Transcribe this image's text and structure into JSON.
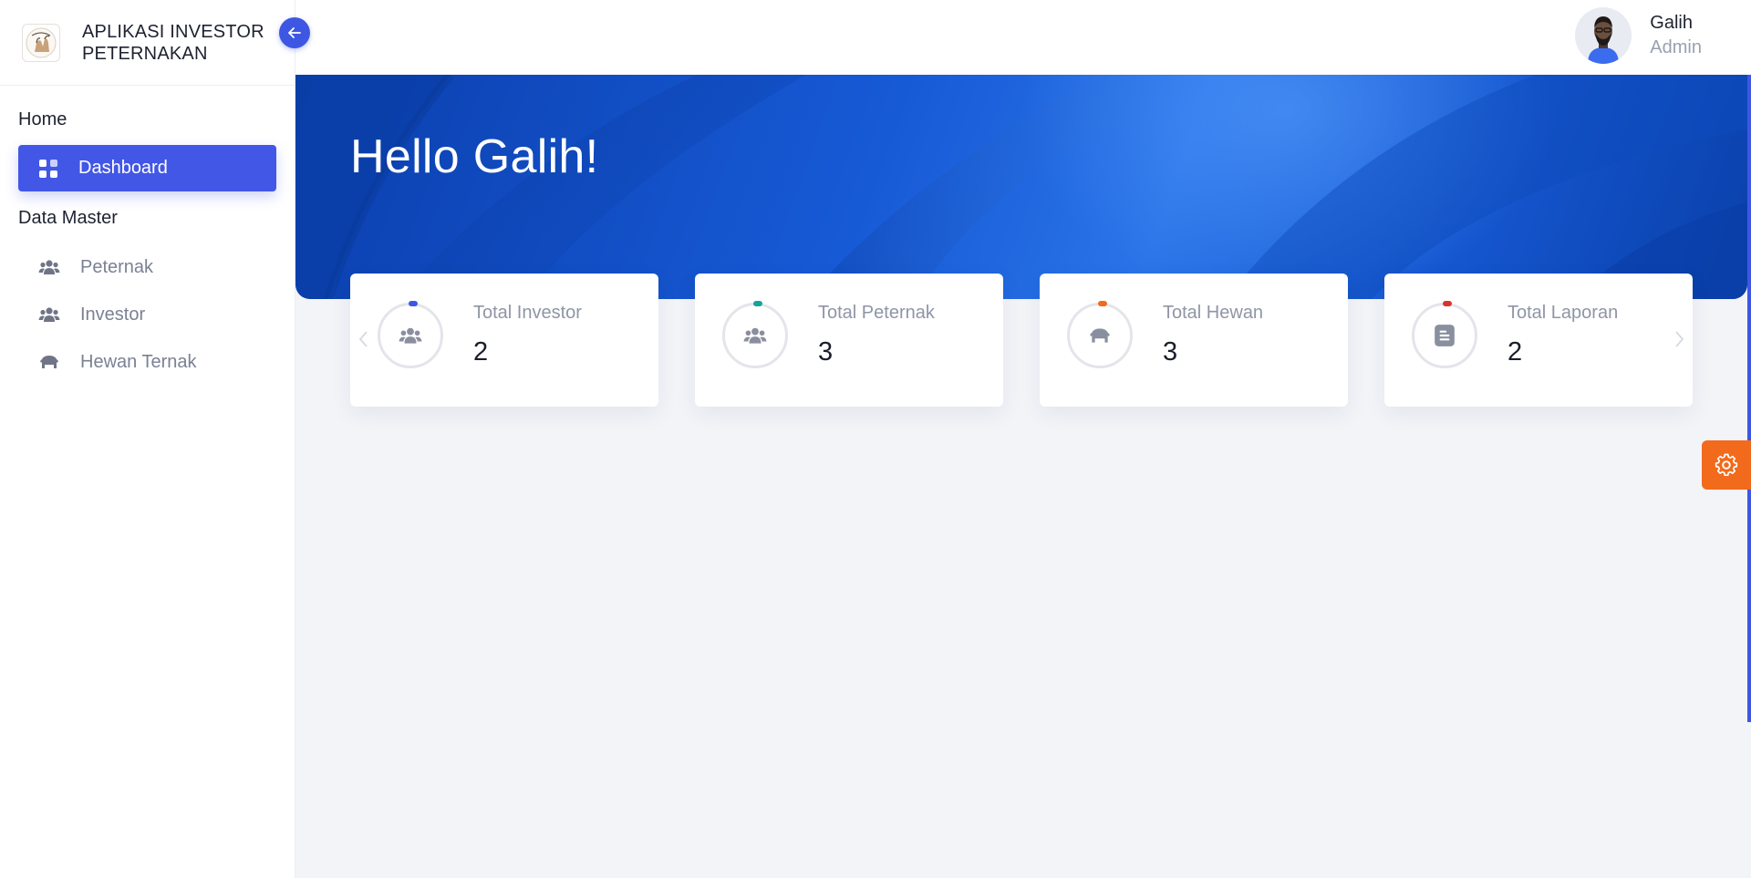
{
  "app": {
    "title": "APLIKASI INVESTOR PETERNAKAN"
  },
  "header": {
    "user_name": "Galih",
    "user_role": "Admin"
  },
  "sidebar": {
    "section_home": "Home",
    "active_item": {
      "label": "Dashboard",
      "icon": "dashboard-icon"
    },
    "section_master": "Data Master",
    "items": [
      {
        "label": "Peternak",
        "icon": "users-icon"
      },
      {
        "label": "Investor",
        "icon": "users-icon"
      },
      {
        "label": "Hewan Ternak",
        "icon": "animal-icon"
      }
    ]
  },
  "hero": {
    "greeting": "Hello Galih!"
  },
  "cards": [
    {
      "title": "Total Investor",
      "value": "2",
      "icon": "users-icon",
      "accent": "#3e57e3"
    },
    {
      "title": "Total Peternak",
      "value": "3",
      "icon": "users-icon",
      "accent": "#15a39a"
    },
    {
      "title": "Total Hewan",
      "value": "3",
      "icon": "animal-icon",
      "accent": "#f26a1b"
    },
    {
      "title": "Total Laporan",
      "value": "2",
      "icon": "report-icon",
      "accent": "#d9342b"
    }
  ],
  "colors": {
    "primary": "#4257e6",
    "hero": "#175ad6",
    "settings": "#f26a1b"
  }
}
